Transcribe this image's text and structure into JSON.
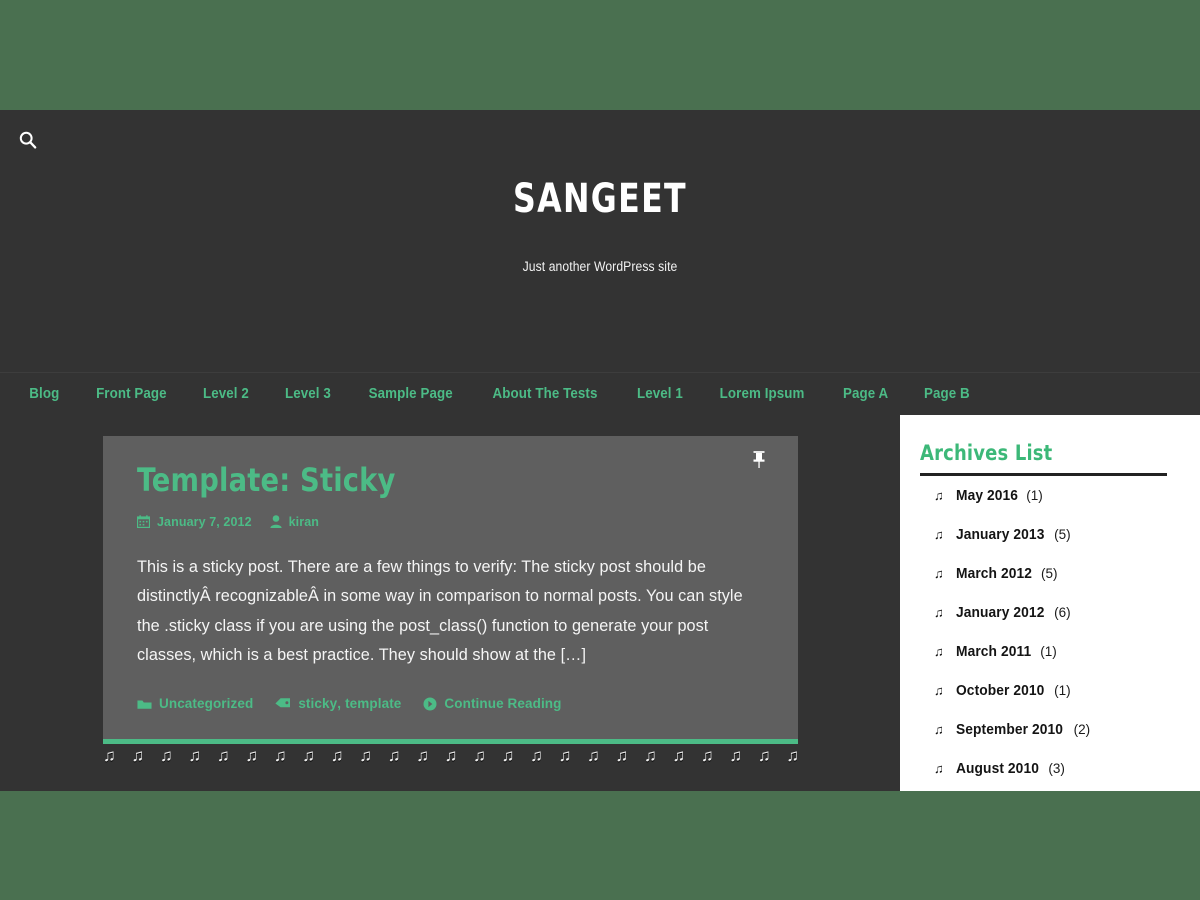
{
  "theme": {
    "outer_background": "#4a7050",
    "header_background": "#333333",
    "accent_green": "#4cbb86",
    "card_background": "#5f5f5f",
    "sidebar_background": "#ffffff"
  },
  "header": {
    "search_icon": "search-icon",
    "site_title": "SANGEET",
    "site_description": "Just another WordPress site"
  },
  "nav": {
    "items": [
      {
        "label": "Blog"
      },
      {
        "label": "Front Page"
      },
      {
        "label": "Level 2"
      },
      {
        "label": "Level 3"
      },
      {
        "label": "Sample Page"
      },
      {
        "label": "About The Tests"
      },
      {
        "label": "Level 1"
      },
      {
        "label": "Lorem Ipsum"
      },
      {
        "label": "Page A"
      },
      {
        "label": "Page B"
      }
    ]
  },
  "post": {
    "title": "Template: Sticky",
    "sticky_icon": "pushpin-icon",
    "date_icon": "calendar-icon",
    "date": "January 7, 2012",
    "author_icon": "user-icon",
    "author": "kiran",
    "summary": "This is a sticky post. There are a few things to verify: The sticky post should be distinctlyÂ recognizableÂ in some way in comparison to normal posts. You can style the .sticky class if you are using the post_class() function to generate your post classes, which is a best practice. They should show at the […]",
    "category_icon": "folder-icon",
    "category": "Uncategorized",
    "tag_icon": "tag-icon",
    "tags": [
      "sticky",
      "template"
    ],
    "tags_separator": ",",
    "continue_icon": "arrow-circle-right-icon",
    "continue_label": "Continue Reading",
    "note_strip_glyph": "♫"
  },
  "sidebar": {
    "widget_title": "Archives List",
    "bullet_icon": "music-note-icon",
    "archives": [
      {
        "label": "May 2016",
        "count": "(1)"
      },
      {
        "label": "January 2013",
        "count": "(5)"
      },
      {
        "label": "March 2012",
        "count": "(5)"
      },
      {
        "label": "January 2012",
        "count": "(6)"
      },
      {
        "label": "March 2011",
        "count": "(1)"
      },
      {
        "label": "October 2010",
        "count": "(1)"
      },
      {
        "label": "September 2010",
        "count": "(2)"
      },
      {
        "label": "August 2010",
        "count": "(3)"
      }
    ]
  }
}
